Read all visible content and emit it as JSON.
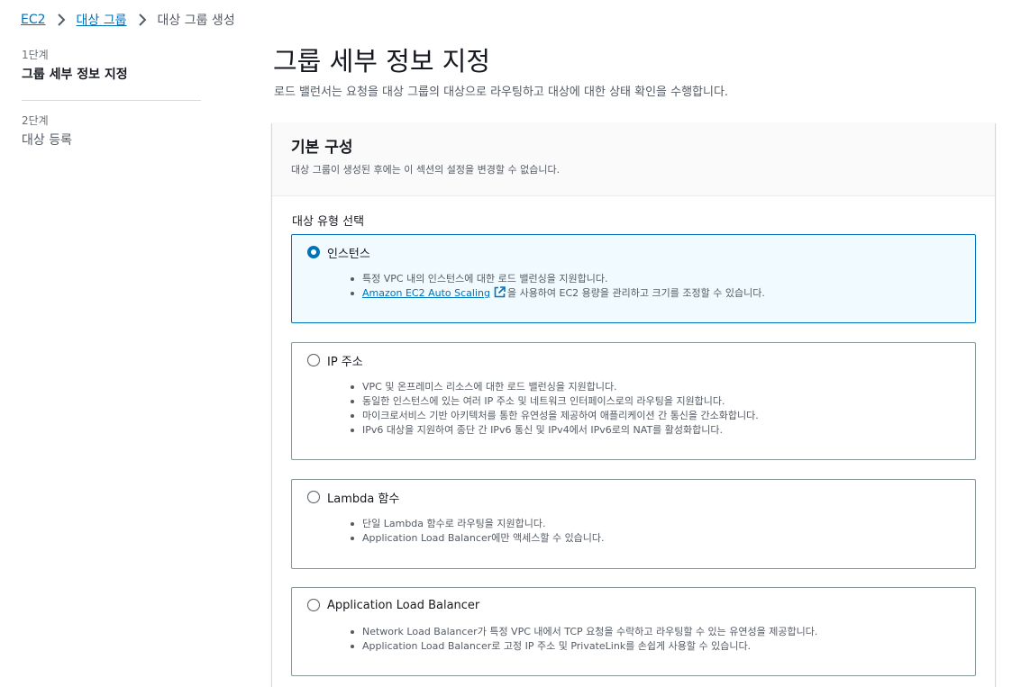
{
  "breadcrumb": {
    "items": [
      "EC2",
      "대상 그룹",
      "대상 그룹 생성"
    ]
  },
  "steps": [
    {
      "number": "1단계",
      "title": "그룹 세부 정보 지정"
    },
    {
      "number": "2단계",
      "title": "대상 등록"
    }
  ],
  "page": {
    "title": "그룹 세부 정보 지정",
    "description": "로드 밸런서는 요청을 대상 그룹의 대상으로 라우팅하고 대상에 대한 상태 확인을 수행합니다."
  },
  "panel": {
    "title": "기본 구성",
    "description": "대상 그룹이 생성된 후에는 이 섹션의 설정을 변경할 수 없습니다."
  },
  "target_type": {
    "label": "대상 유형 선택",
    "selected": "인스턴스",
    "options": [
      {
        "label": "인스턴스",
        "bullets": [
          "특정 VPC 내의 인스턴스에 대한 로드 밸런싱을 지원합니다."
        ],
        "link_text": "Amazon EC2 Auto Scaling",
        "link_suffix": "을 사용하여 EC2 용량을 관리하고 크기를 조정할 수 있습니다."
      },
      {
        "label": "IP 주소",
        "bullets": [
          "VPC 및 온프레미스 리소스에 대한 로드 밸런싱을 지원합니다.",
          "동일한 인스턴스에 있는 여러 IP 주소 및 네트워크 인터페이스로의 라우팅을 지원합니다.",
          "마이크로서비스 기반 아키텍처를 통한 유연성을 제공하여 애플리케이션 간 통신을 간소화합니다.",
          "IPv6 대상을 지원하여 종단 간 IPv6 통신 및 IPv4에서 IPv6로의 NAT를 활성화합니다."
        ]
      },
      {
        "label": "Lambda 함수",
        "bullets": [
          "단일 Lambda 함수로 라우팅을 지원합니다.",
          "Application Load Balancer에만 액세스할 수 있습니다."
        ]
      },
      {
        "label": "Application Load Balancer",
        "bullets": [
          "Network Load Balancer가 특정 VPC 내에서 TCP 요청을 수락하고 라우팅할 수 있는 유연성을 제공합니다.",
          "Application Load Balancer로 고정 IP 주소 및 PrivateLink를 손쉽게 사용할 수 있습니다."
        ]
      }
    ]
  },
  "colors": {
    "link": "#0073bb",
    "selected_border": "#0073bb",
    "selected_bg": "#f1faff"
  }
}
